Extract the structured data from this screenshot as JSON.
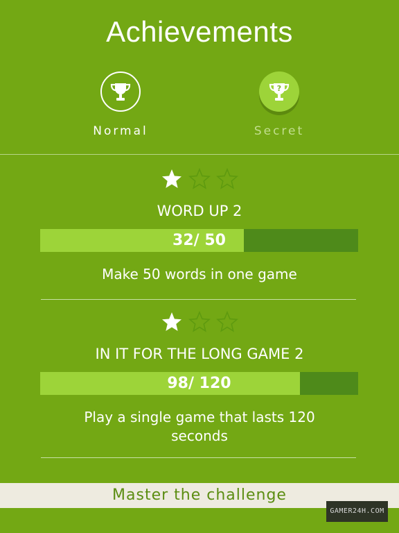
{
  "header": {
    "title": "Achievements"
  },
  "tabs": [
    {
      "label": "Normal",
      "icon": "trophy-icon",
      "active": true
    },
    {
      "label": "Secret",
      "icon": "trophy-question-icon",
      "active": false
    }
  ],
  "achievements": [
    {
      "stars_earned": 1,
      "stars_total": 3,
      "name": "WORD UP 2",
      "progress_text": "32/ 50",
      "progress_fraction": 0.64,
      "description": "Make 50 words in one game"
    },
    {
      "stars_earned": 1,
      "stars_total": 3,
      "name": "IN IT FOR THE LONG GAME 2",
      "progress_text": "98/ 120",
      "progress_fraction": 0.8167,
      "description": "Play a single game that lasts 120 seconds"
    }
  ],
  "footer": {
    "label": "Master the challenge"
  },
  "watermark": {
    "text": "GAMER24H.COM"
  },
  "colors": {
    "background": "#73a814",
    "bar_fill": "#9dd439",
    "bar_track": "#4e8a1a",
    "footer_bg": "#eeebe0",
    "footer_text": "#5b8d11"
  }
}
